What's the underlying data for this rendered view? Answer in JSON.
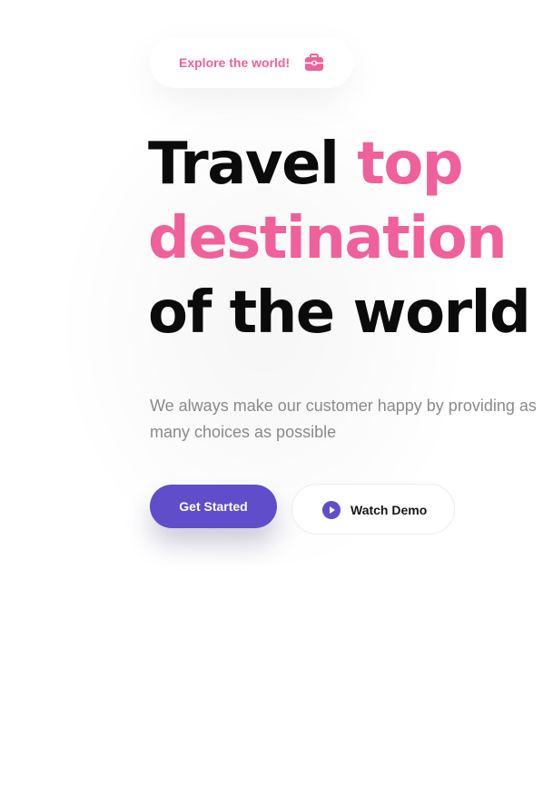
{
  "badge": {
    "label": "Explore the world!",
    "icon": "briefcase-icon"
  },
  "hero": {
    "line1_plain": "Travel ",
    "line1_accent": "top",
    "line2_accent": "destination",
    "line3_plain": "of the world",
    "subtitle": "We always make our customer happy by providing as many choices as possible"
  },
  "actions": {
    "primary_label": "Get Started",
    "secondary_label": "Watch Demo",
    "secondary_icon": "play-icon"
  },
  "colors": {
    "accent_pink": "#f0609a",
    "primary_purple": "#5f4dc9",
    "text_dark": "#0b0b0b",
    "text_muted": "#8a8a8a"
  }
}
